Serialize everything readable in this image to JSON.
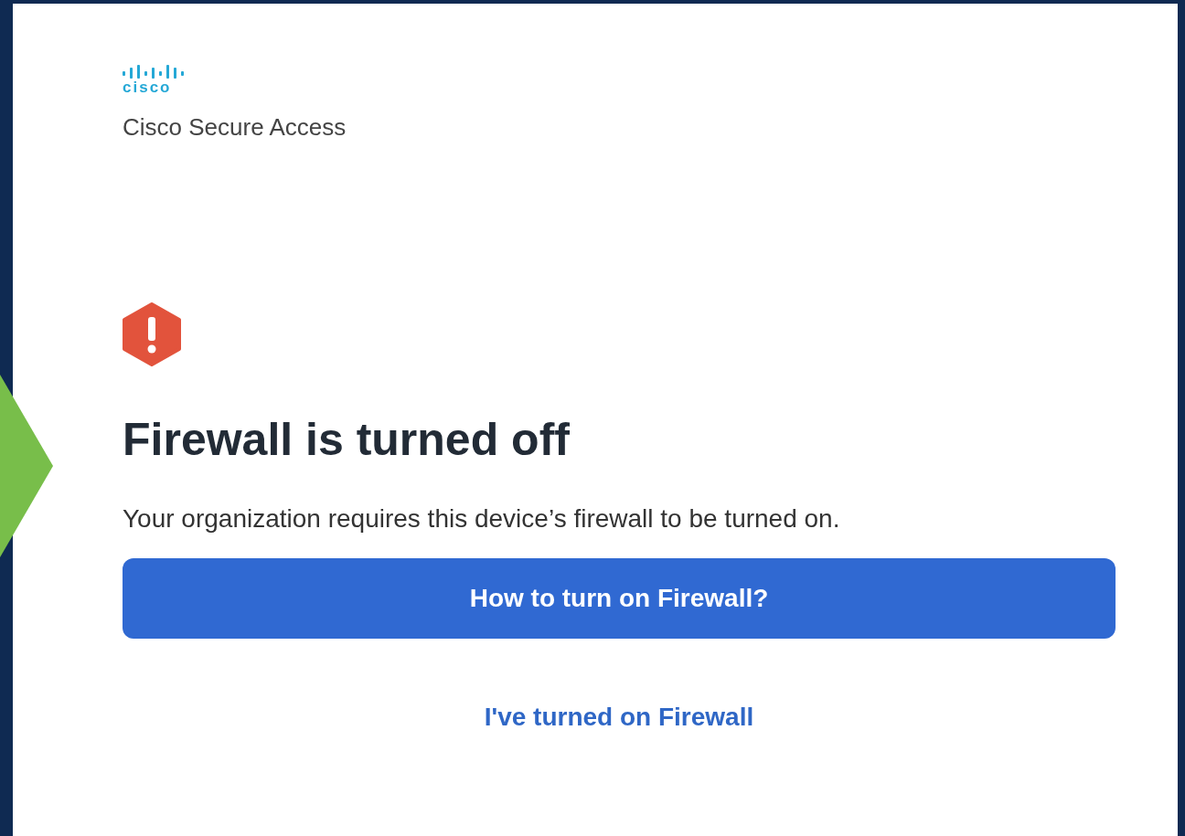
{
  "logo": {
    "wordmark": "cisco"
  },
  "app_name": "Cisco Secure Access",
  "alert": {
    "title": "Firewall is turned off",
    "message": "Your organization requires this device’s firewall to be turned on."
  },
  "primary_button": "How to turn on Firewall?",
  "link": "I've turned on Firewall"
}
